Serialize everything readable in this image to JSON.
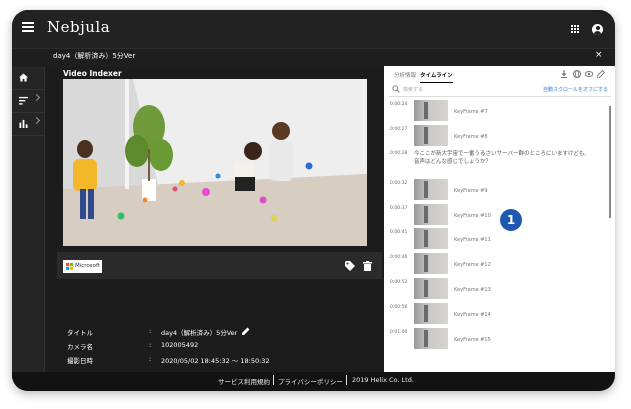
{
  "app": {
    "logo": "Nebjula"
  },
  "titlebar": {
    "title": "day4（解析済み）5分Ver",
    "close": "×"
  },
  "video_indexer": {
    "label": "Video Indexer"
  },
  "controls": {
    "brand": "Microsoft"
  },
  "metadata": [
    {
      "key": "タイトル",
      "colon": ":",
      "value": "day4（解析済み）5分Ver"
    },
    {
      "key": "カメラ名",
      "colon": ":",
      "value": "102005492"
    },
    {
      "key": "撮影日時",
      "colon": ":",
      "value": "2020/05/02 18:45:32 〜 18:50:32"
    }
  ],
  "panel": {
    "tabs": [
      {
        "label": "分析情報",
        "active": false
      },
      {
        "label": "タイムライン",
        "active": true
      }
    ],
    "search_placeholder": "検索する",
    "autoscroll_label": "自動スクロールをオフにする",
    "timeline": [
      {
        "time": "0:00:24",
        "kind": "frame",
        "label": "KeyFrame #7"
      },
      {
        "time": "0:00:27",
        "kind": "frame",
        "label": "KeyFrame #8"
      },
      {
        "time": "0:00:28",
        "kind": "transcript",
        "label": "今ここが新大宇宙で一番うるさいサーバー群のところにいますけども、音声はどんな感じでしょうか？"
      },
      {
        "time": "0:00:32",
        "kind": "frame",
        "label": "KeyFrame #9"
      },
      {
        "time": "0:00:37",
        "kind": "frame",
        "label": "KeyFrame #10"
      },
      {
        "time": "0:00:41",
        "kind": "frame",
        "label": "KeyFrame #11"
      },
      {
        "time": "0:00:46",
        "kind": "frame",
        "label": "KeyFrame #12"
      },
      {
        "time": "0:00:52",
        "kind": "frame",
        "label": "KeyFrame #13"
      },
      {
        "time": "0:00:56",
        "kind": "frame",
        "label": "KeyFrame #14"
      },
      {
        "time": "0:01:00",
        "kind": "frame",
        "label": "KeyFrame #15"
      }
    ]
  },
  "badge": {
    "number": "1"
  },
  "footer": {
    "terms": "サービス利用規約",
    "privacy": "プライバシーポリシー",
    "copyright": "2019 Helix Co. Ltd."
  },
  "colors": {
    "accent": "#1f58b0",
    "link": "#3a7dd0",
    "frame": "#1c1c1c"
  }
}
